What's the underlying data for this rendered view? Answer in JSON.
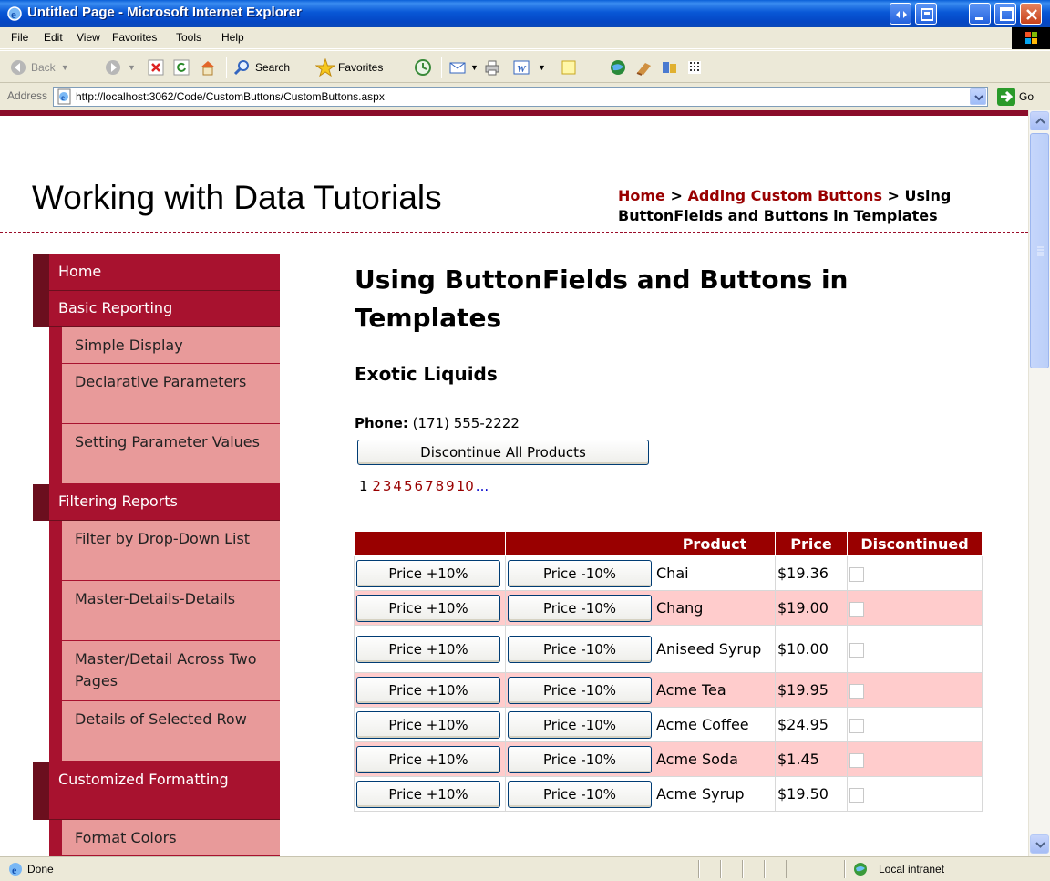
{
  "window": {
    "title": "Untitled Page - Microsoft Internet Explorer"
  },
  "menu": [
    "File",
    "Edit",
    "View",
    "Favorites",
    "Tools",
    "Help"
  ],
  "toolbar": {
    "back": "Back",
    "search": "Search",
    "favorites": "Favorites"
  },
  "address": {
    "label": "Address",
    "url": "http://localhost:3062/Code/CustomButtons/CustomButtons.aspx",
    "go": "Go"
  },
  "page": {
    "site_title": "Working with Data Tutorials",
    "breadcrumb": {
      "home": "Home",
      "sep1": " > ",
      "parent": "Adding Custom Buttons",
      "sep2": " > ",
      "current": "Using ButtonFields and Buttons in Templates"
    },
    "heading": "Using ButtonFields and Buttons in Templates",
    "supplier": "Exotic Liquids",
    "phone_label": "Phone:",
    "phone_value": " (171) 555-2222",
    "discontinue_label": "Discontinue All Products",
    "pager": {
      "current": "1",
      "pages": [
        "2",
        "3",
        "4",
        "5",
        "6",
        "7",
        "8",
        "9",
        "10"
      ],
      "more": "..."
    }
  },
  "nav": [
    {
      "label": "Home",
      "sub": []
    },
    {
      "label": "Basic Reporting",
      "sub": [
        "Simple Display",
        "Declarative Parameters",
        "Setting Parameter Values"
      ]
    },
    {
      "label": "Filtering Reports",
      "sub": [
        "Filter by Drop-Down List",
        "Master-Details-Details",
        "Master/Detail Across Two Pages",
        "Details of Selected Row"
      ]
    },
    {
      "label": "Customized Formatting",
      "sub": [
        "Format Colors"
      ]
    }
  ],
  "grid": {
    "headers": [
      "",
      "",
      "Product",
      "Price",
      "Discontinued"
    ],
    "button_up": "Price +10%",
    "button_down": "Price -10%",
    "rows": [
      {
        "product": "Chai",
        "price": "$19.36"
      },
      {
        "product": "Chang",
        "price": "$19.00"
      },
      {
        "product": "Aniseed Syrup",
        "price": "$10.00"
      },
      {
        "product": "Acme Tea",
        "price": "$19.95"
      },
      {
        "product": "Acme Coffee",
        "price": "$24.95"
      },
      {
        "product": "Acme Soda",
        "price": "$1.45"
      },
      {
        "product": "Acme Syrup",
        "price": "$19.50"
      }
    ]
  },
  "status": {
    "text": "Done",
    "zone": "Local intranet"
  }
}
